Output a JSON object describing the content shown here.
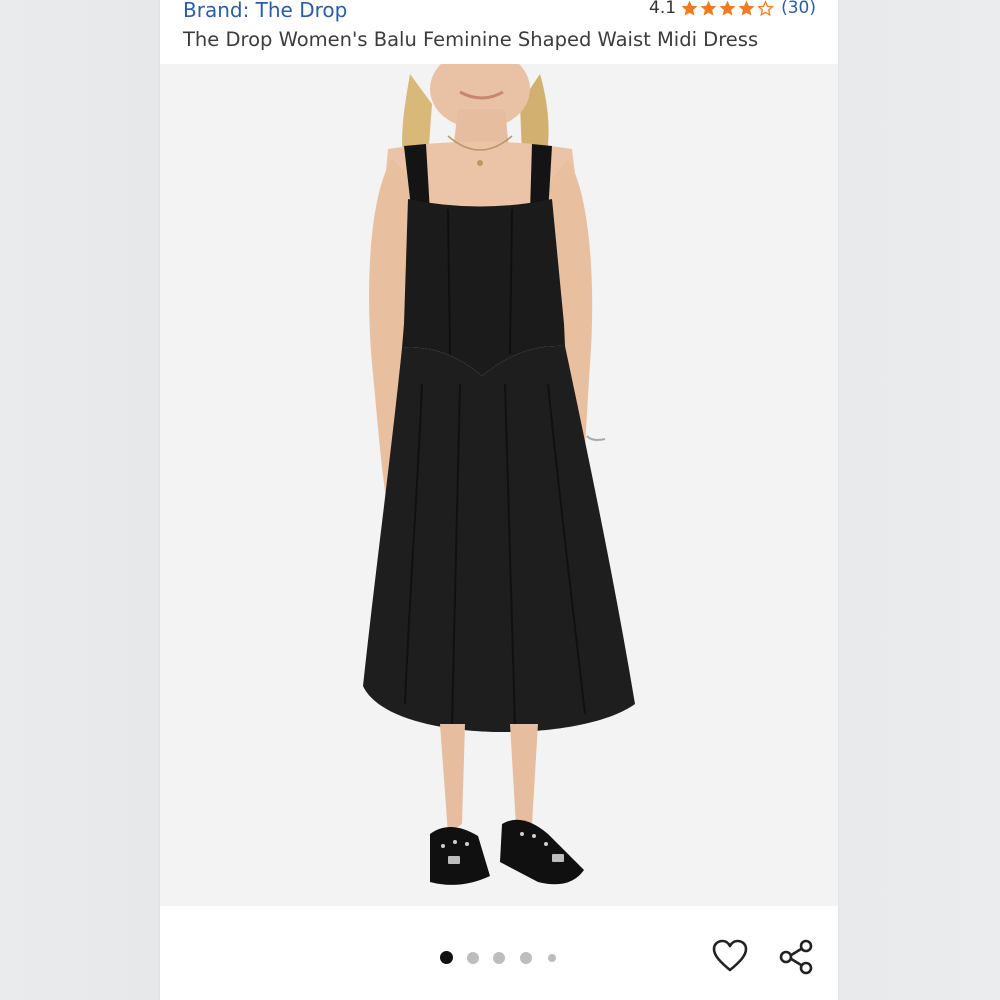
{
  "product": {
    "brand": "Brand: The Drop",
    "rating_value": "4.1",
    "rating_stars": 4.1,
    "review_count": "(30)",
    "title": "The Drop Women's Balu Feminine Shaped Waist Midi Dress"
  },
  "image_carousel": {
    "total_images": 5,
    "active_index": 0
  },
  "actions": {
    "favorite_icon": "heart-outline-icon",
    "share_icon": "share-icon"
  },
  "colors": {
    "brand_link": "#2a5da6",
    "star": "#f47a1f",
    "dot_active": "#111111",
    "dot_inactive": "#bdbdbd"
  }
}
